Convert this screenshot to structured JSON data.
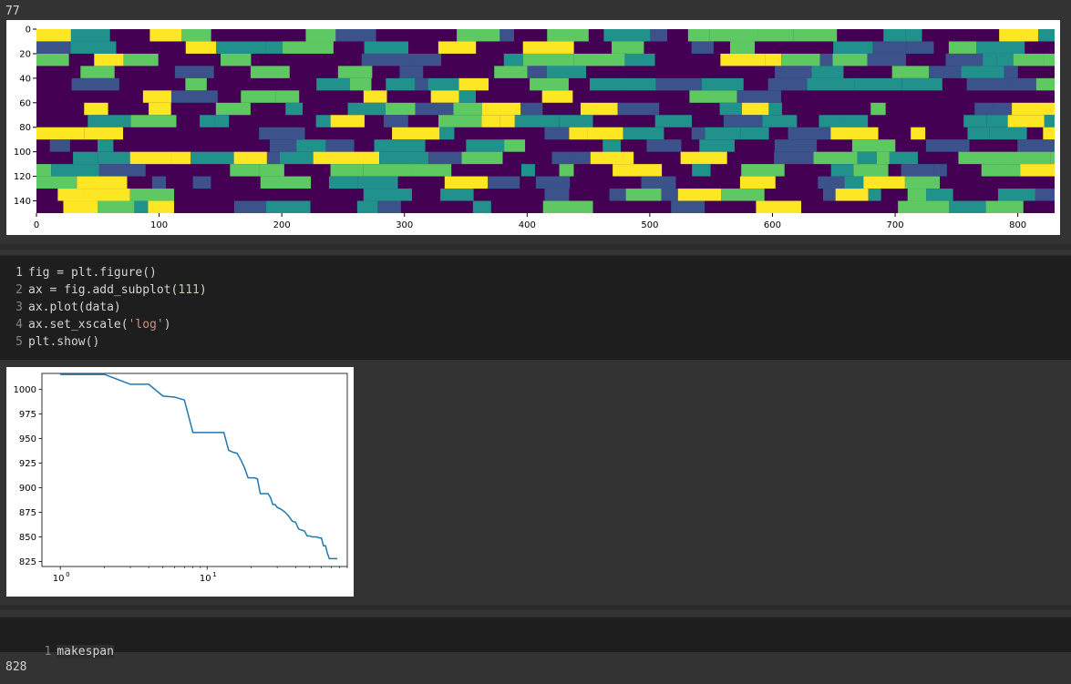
{
  "cells": {
    "out1_text": "77",
    "code1": {
      "lines": [
        {
          "n": "1",
          "a": "fig = plt.figure()"
        },
        {
          "n": "2",
          "a": "ax = fig.add_subplot(",
          "num": "111",
          "b": ")"
        },
        {
          "n": "3",
          "a": "ax.plot(data)"
        },
        {
          "n": "4",
          "a": "ax.set_xscale(",
          "str": "'log'",
          "b": ")"
        },
        {
          "n": "5",
          "a": "plt.show()"
        }
      ]
    },
    "code2": {
      "line_no": "1",
      "text": "makespan"
    },
    "out2_text": "828"
  },
  "colors": {
    "notebook_bg": "#333333",
    "code_bg": "#1e1e1e",
    "line_color": "#1f77b4",
    "viridis": [
      "#440154",
      "#3b528b",
      "#21918c",
      "#5ec962",
      "#fde725"
    ]
  },
  "chart_data": [
    {
      "type": "heatmap",
      "colormap": "viridis",
      "xlim": [
        0,
        830
      ],
      "ylim": [
        150,
        0
      ],
      "xticks": [
        "0",
        "100",
        "200",
        "300",
        "400",
        "500",
        "600",
        "700",
        "800"
      ],
      "yticks": [
        "0",
        "20",
        "40",
        "60",
        "80",
        "100",
        "120",
        "140"
      ],
      "grid": false
    },
    {
      "type": "line",
      "xscale": "log",
      "xlim": [
        0.75,
        90
      ],
      "ylim": [
        820,
        1016
      ],
      "xticks": [
        {
          "value": 1,
          "base": "10",
          "exp": "0"
        },
        {
          "value": 10,
          "base": "10",
          "exp": "1"
        }
      ],
      "yticks": [
        "825",
        "850",
        "875",
        "900",
        "925",
        "950",
        "975",
        "1000"
      ],
      "x": [
        1,
        2,
        3,
        4,
        5,
        6,
        7,
        8,
        9,
        10,
        11,
        12,
        13,
        14,
        15,
        16,
        17,
        18,
        19,
        20,
        21,
        22,
        23,
        24,
        25,
        26,
        27,
        28,
        29,
        30,
        32,
        34,
        36,
        38,
        40,
        42,
        44,
        46,
        48,
        50,
        52,
        54,
        56,
        58,
        60,
        62,
        64,
        66,
        68,
        70,
        72,
        74,
        77
      ],
      "values": [
        1015,
        1015,
        1005,
        1005,
        993,
        992,
        989,
        956,
        956,
        956,
        956,
        956,
        956,
        938,
        936,
        935,
        928,
        920,
        910,
        910,
        910,
        909,
        894,
        894,
        894,
        894,
        890,
        883,
        883,
        880,
        878,
        875,
        871,
        866,
        865,
        858,
        857,
        856,
        851,
        851,
        850,
        850,
        850,
        849,
        849,
        841,
        841,
        833,
        828,
        828,
        828,
        828,
        828
      ],
      "grid": false
    }
  ]
}
